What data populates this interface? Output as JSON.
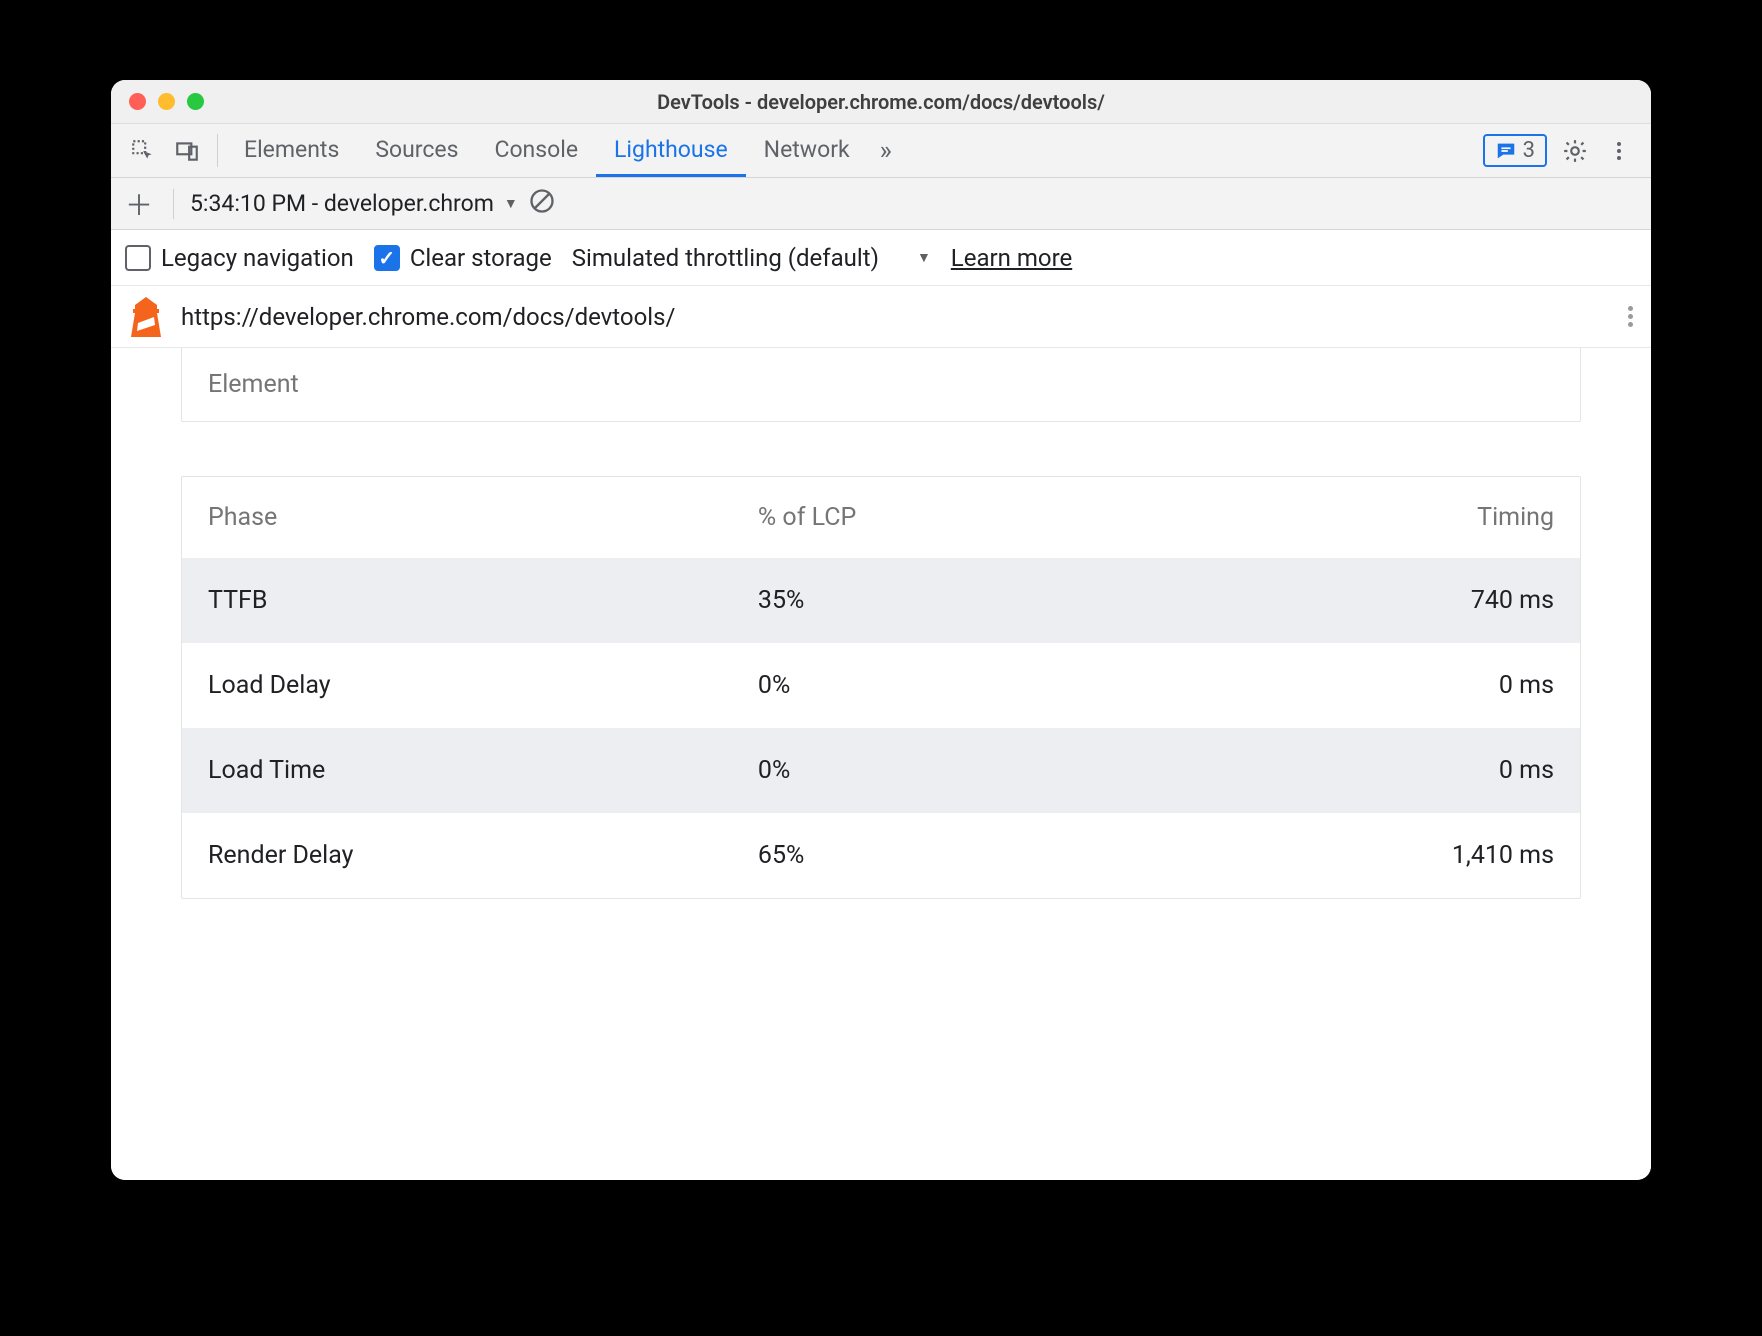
{
  "window": {
    "title": "DevTools - developer.chrome.com/docs/devtools/"
  },
  "tabs": {
    "items": [
      "Elements",
      "Sources",
      "Console",
      "Lighthouse",
      "Network"
    ],
    "active_index": 3,
    "messages_count": "3"
  },
  "toolbar": {
    "report_label": "5:34:10 PM - developer.chrom"
  },
  "options": {
    "legacy_label": "Legacy navigation",
    "legacy_checked": false,
    "clear_label": "Clear storage",
    "clear_checked": true,
    "throttle_label": "Simulated throttling (default)",
    "learn_more": "Learn more"
  },
  "url_row": {
    "url": "https://developer.chrome.com/docs/devtools/"
  },
  "element_card": {
    "label": "Element"
  },
  "lcp_table": {
    "headers": [
      "Phase",
      "% of LCP",
      "Timing"
    ],
    "rows": [
      {
        "phase": "TTFB",
        "pct": "35%",
        "timing": "740 ms"
      },
      {
        "phase": "Load Delay",
        "pct": "0%",
        "timing": "0 ms"
      },
      {
        "phase": "Load Time",
        "pct": "0%",
        "timing": "0 ms"
      },
      {
        "phase": "Render Delay",
        "pct": "65%",
        "timing": "1,410 ms"
      }
    ]
  }
}
